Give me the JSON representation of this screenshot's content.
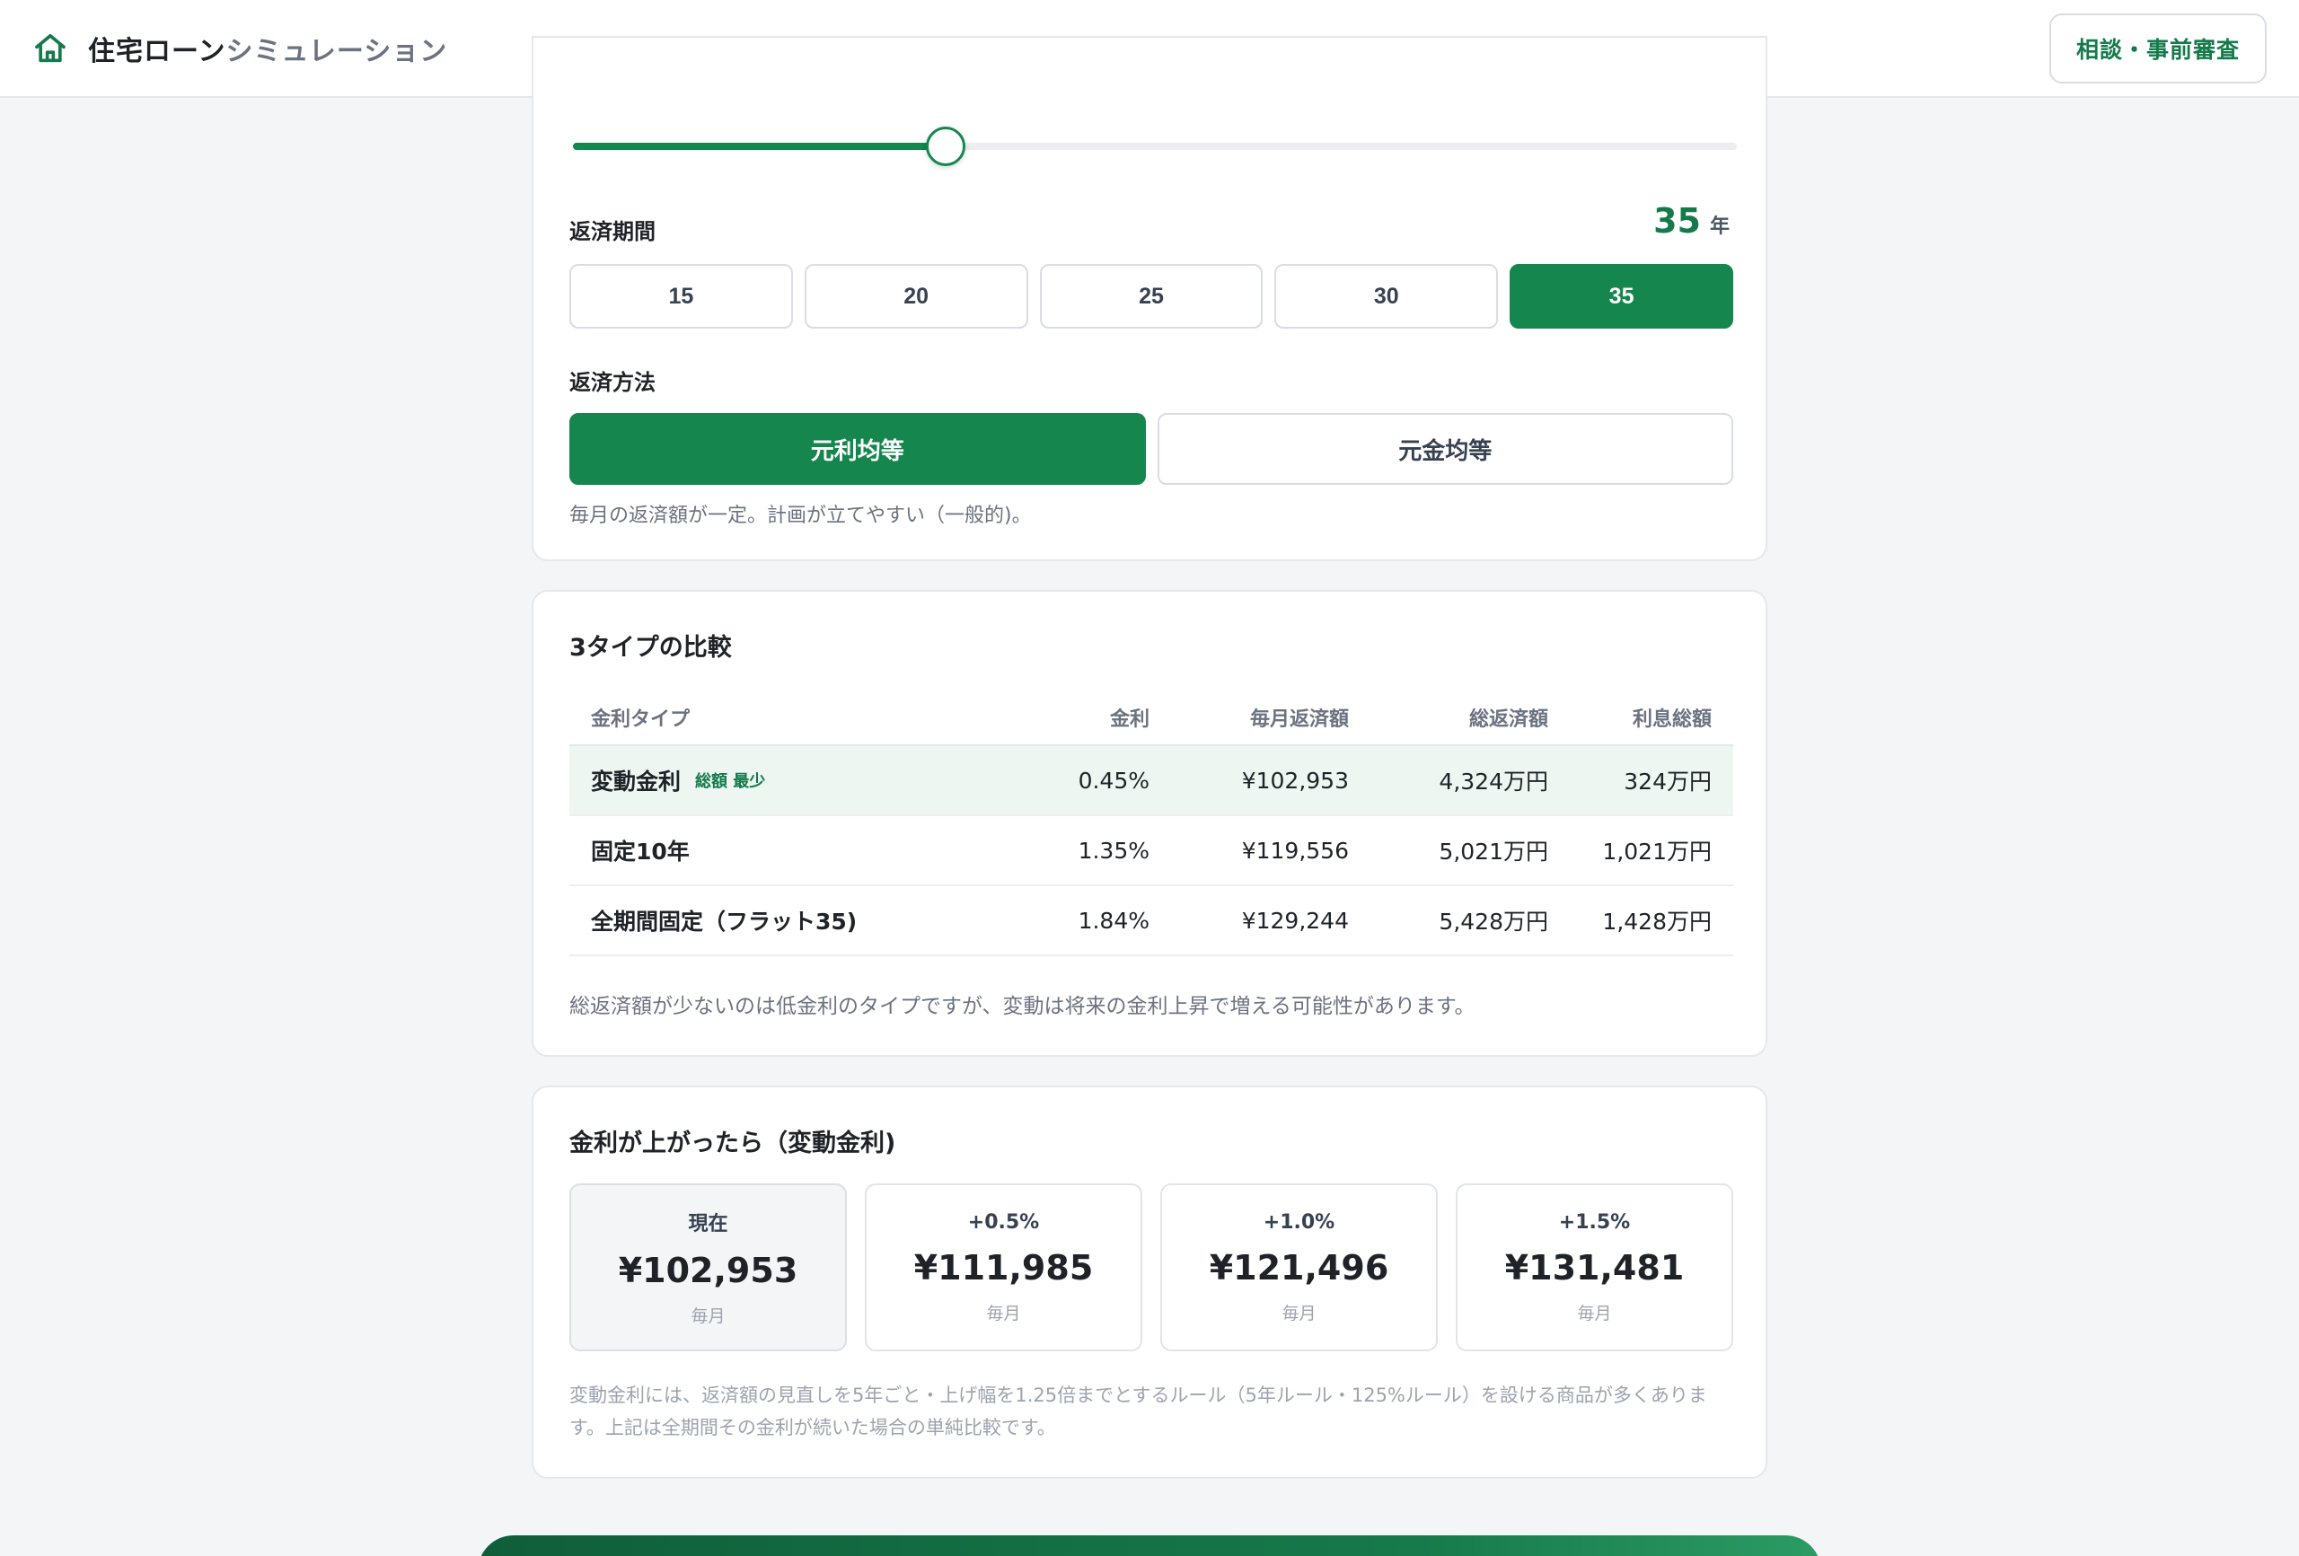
{
  "header": {
    "title_strong": "住宅ローン",
    "title_light": "シミュレーション",
    "consult_button": "相談・事前審査"
  },
  "colors": {
    "accent": "#16864f",
    "accent_text": "#157a4b"
  },
  "settings": {
    "amount_slider_level_percent": 32,
    "term": {
      "label": "返済期間",
      "value": "35",
      "unit": "年",
      "options": [
        "15",
        "20",
        "25",
        "30",
        "35"
      ],
      "selected": "35"
    },
    "method": {
      "label": "返済方法",
      "options": [
        "元利均等",
        "元金均等"
      ],
      "selected": "元利均等",
      "note": "毎月の返済額が一定。計画が立てやすい（一般的)。"
    }
  },
  "comparison": {
    "title": "3タイプの比較",
    "headers": {
      "type": "金利タイプ",
      "rate": "金利",
      "monthly": "毎月返済額",
      "total": "総返済額",
      "interest": "利息総額"
    },
    "rows": [
      {
        "type": "変動金利",
        "badge": "総額 最少",
        "rate": "0.45%",
        "monthly": "¥102,953",
        "total": "4,324万円",
        "interest": "324万円"
      },
      {
        "type": "固定10年",
        "badge": "",
        "rate": "1.35%",
        "monthly": "¥119,556",
        "total": "5,021万円",
        "interest": "1,021万円"
      },
      {
        "type": "全期間固定（フラット35)",
        "badge": "",
        "rate": "1.84%",
        "monthly": "¥129,244",
        "total": "5,428万円",
        "interest": "1,428万円"
      }
    ],
    "note": "総返済額が少ないのは低金利のタイプですが、変動は将来の金利上昇で増える可能性があります。"
  },
  "rate_rise": {
    "title": "金利が上がったら（変動金利)",
    "scenarios": [
      {
        "label": "現在",
        "amount": "¥102,953",
        "unit": "毎月"
      },
      {
        "label": "+0.5%",
        "amount": "¥111,985",
        "unit": "毎月"
      },
      {
        "label": "+1.0%",
        "amount": "¥121,496",
        "unit": "毎月"
      },
      {
        "label": "+1.5%",
        "amount": "¥131,481",
        "unit": "毎月"
      }
    ],
    "note": "変動金利には、返済額の見直しを5年ごと・上げ幅を1.25倍までとするルール（5年ルール・125%ルール）を設ける商品が多くあります。上記は全期間その金利が続いた場合の単純比較です。"
  }
}
